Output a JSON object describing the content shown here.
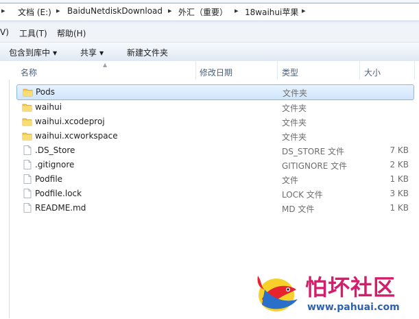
{
  "address": {
    "crumbs": [
      "文档 (E:)",
      "BaiduNetdiskDownload",
      "外汇（重要）",
      "18waihui苹果"
    ]
  },
  "menu": {
    "items": [
      "V)",
      "工具(T)",
      "帮助(H)"
    ]
  },
  "toolbar": {
    "include_label": "包含到库中",
    "share_label": "共享",
    "new_folder_label": "新建文件夹"
  },
  "columns": {
    "name": "名称",
    "date": "修改日期",
    "type": "类型",
    "size": "大小"
  },
  "files": [
    {
      "name": "Pods",
      "type": "文件夹",
      "size": "",
      "icon": "folder-icon",
      "selected": true
    },
    {
      "name": "waihui",
      "type": "文件夹",
      "size": "",
      "icon": "folder-icon"
    },
    {
      "name": "waihui.xcodeproj",
      "type": "文件夹",
      "size": "",
      "icon": "folder-icon"
    },
    {
      "name": "waihui.xcworkspace",
      "type": "文件夹",
      "size": "",
      "icon": "folder-icon"
    },
    {
      "name": ".DS_Store",
      "type": "DS_STORE 文件",
      "size": "7 KB",
      "icon": "file-icon"
    },
    {
      "name": ".gitignore",
      "type": "GITIGNORE 文件",
      "size": "2 KB",
      "icon": "file-icon"
    },
    {
      "name": "Podfile",
      "type": "文件",
      "size": "1 KB",
      "icon": "file-icon"
    },
    {
      "name": "Podfile.lock",
      "type": "LOCK 文件",
      "size": "3 KB",
      "icon": "file-icon"
    },
    {
      "name": "README.md",
      "type": "MD 文件",
      "size": "1 KB",
      "icon": "file-icon"
    }
  ],
  "watermark": {
    "title": "怕坏社区",
    "url": "www.pahuai.com"
  },
  "colors": {
    "selection": "#cfe5fc",
    "selection_border": "#86b9ee",
    "folder": "#f3c94a",
    "watermark_title": "#d41d6b",
    "watermark_url": "#2e62b0"
  }
}
